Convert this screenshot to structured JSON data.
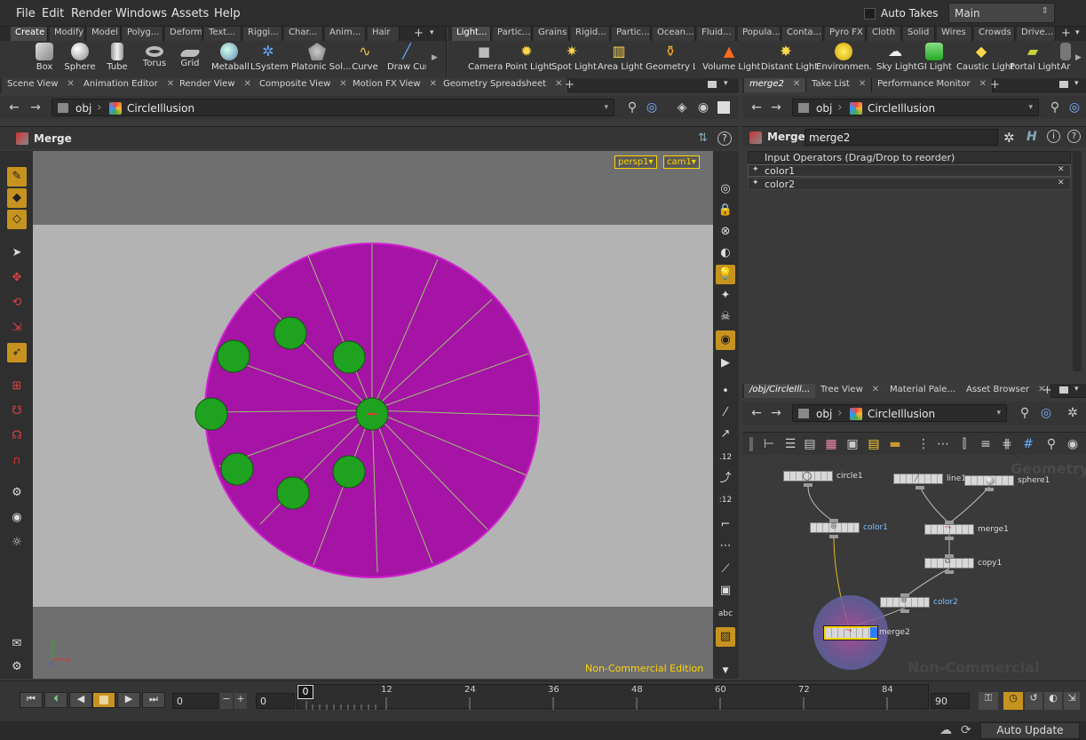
{
  "menubar": {
    "items": [
      "File",
      "Edit",
      "Render",
      "Windows",
      "Assets",
      "Help"
    ],
    "auto_takes": "Auto Takes",
    "desktop": "Main"
  },
  "shelf_left": {
    "tabs": [
      "Create",
      "Modify",
      "Model",
      "Polyg...",
      "Deform",
      "Text...",
      "Riggi...",
      "Char...",
      "Anim...",
      "Hair"
    ],
    "tools": [
      "Box",
      "Sphere",
      "Tube",
      "Torus",
      "Grid",
      "Metaball",
      "LSystem",
      "Platonic Sol...",
      "Curve",
      "Draw Curv"
    ]
  },
  "shelf_right": {
    "tabs": [
      "Light...",
      "Partic...",
      "Grains",
      "Rigid...",
      "Partic...",
      "Ocean...",
      "Fluid...",
      "Popula...",
      "Conta...",
      "Pyro FX",
      "Cloth",
      "Solid",
      "Wires",
      "Crowds",
      "Drive..."
    ],
    "tools": [
      "Camera",
      "Point Light",
      "Spot Light",
      "Area Light",
      "Geometry L...",
      "Volume Light",
      "Distant Light",
      "Environmen...",
      "Sky Light",
      "GI Light",
      "Caustic Light",
      "Portal Light",
      "Ar"
    ]
  },
  "left_pane": {
    "tabs": [
      "Scene View",
      "Animation Editor",
      "Render View",
      "Composite View",
      "Motion FX View",
      "Geometry Spreadsheet"
    ],
    "path_root": "obj",
    "path_node": "CircleIllusion",
    "context_title": "Merge",
    "camera_menu": "persp1",
    "cam_menu": "cam1",
    "watermark": "Non-Commercial Edition"
  },
  "param_pane": {
    "tabs": [
      "merge2",
      "Take List",
      "Performance Monitor"
    ],
    "path_root": "obj",
    "path_node": "CircleIllusion",
    "node_type": "Merge",
    "node_name": "merge2",
    "list_header": "Input Operators (Drag/Drop to reorder)",
    "inputs": [
      "color1",
      "color2"
    ]
  },
  "network_pane": {
    "tabs": [
      "/obj/CircleIll...",
      "Tree View",
      "Material Pale...",
      "Asset Browser"
    ],
    "path_root": "obj",
    "path_node": "CircleIllusion",
    "context_label": "Geometry",
    "watermark": "Non-Commercial Edition",
    "nodes": {
      "circle1": "circle1",
      "line1": "line1",
      "sphere1": "sphere1",
      "color1": "color1",
      "merge1": "merge1",
      "copy1": "copy1",
      "color2": "color2",
      "merge2": "merge2"
    }
  },
  "timeline": {
    "frame": "0",
    "start": "0",
    "current": "0",
    "end": "90",
    "ticks": [
      "12",
      "24",
      "36",
      "48",
      "60",
      "72",
      "84"
    ],
    "playhead": "0"
  },
  "status": {
    "auto_update": "Auto Update"
  },
  "colors": {
    "accent": "#c7931f",
    "magenta_disk": "#a514a5",
    "sphere": "#1fa21f",
    "highlight_yellow": "#ffd400"
  }
}
